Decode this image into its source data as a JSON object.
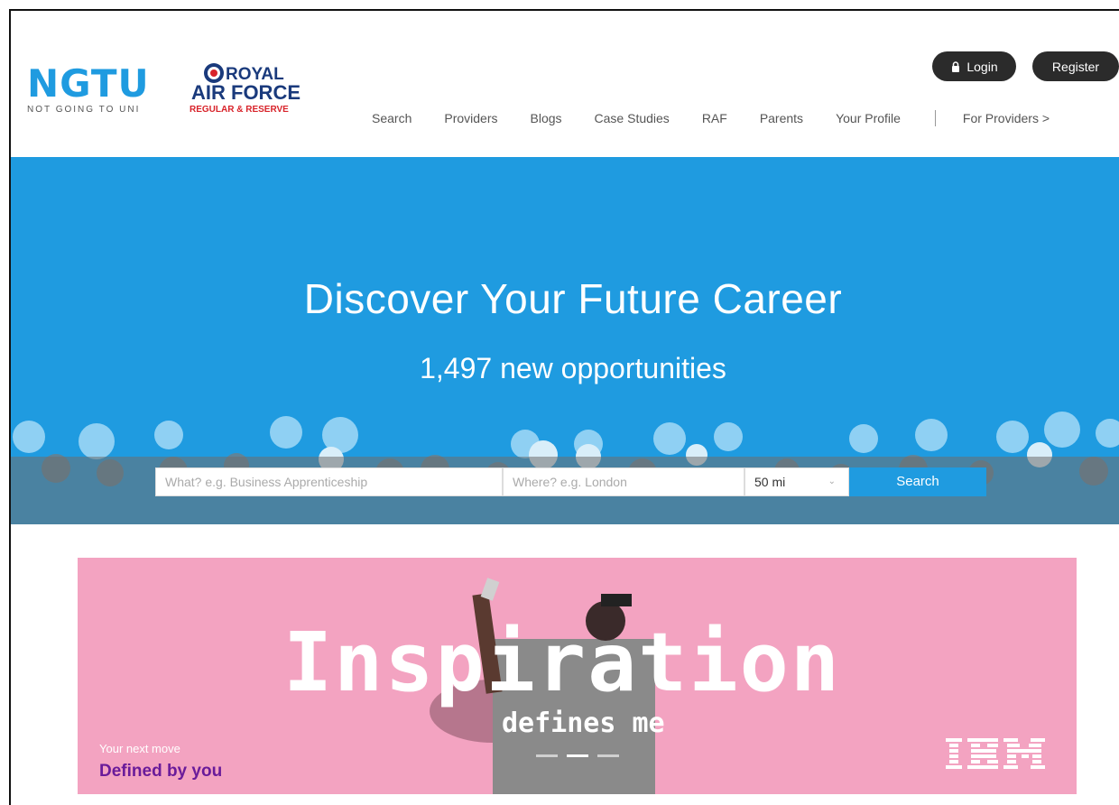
{
  "header": {
    "ngtu_logo": {
      "mark": "NGTU",
      "tagline": "NOT GOING TO UNI"
    },
    "raf_logo": {
      "line1": "ROYAL",
      "line2": "AIR FORCE",
      "line3": "REGULAR & RESERVE"
    },
    "login_label": "Login",
    "register_label": "Register",
    "nav": [
      {
        "label": "Search"
      },
      {
        "label": "Providers"
      },
      {
        "label": "Blogs"
      },
      {
        "label": "Case Studies"
      },
      {
        "label": "RAF"
      },
      {
        "label": "Parents"
      },
      {
        "label": "Your Profile"
      }
    ],
    "for_providers_label": "For Providers >"
  },
  "hero": {
    "title": "Discover Your Future Career",
    "subtitle": "1,497 new opportunities",
    "search": {
      "what_placeholder": "What? e.g. Business Apprenticeship",
      "where_placeholder": "Where? e.g. London",
      "radius_value": "50 mi",
      "button_label": "Search"
    }
  },
  "banner": {
    "headline": "Inspiration",
    "subline": "defines me",
    "next_move": "Your next move",
    "defined_by_you": "Defined by you",
    "ibm_logo": "IBM",
    "slides": 3,
    "active_slide": 2
  },
  "colors": {
    "brand_blue": "#1f9be0",
    "banner_pink": "#f3a3c1",
    "dark_button": "#2b2b2b",
    "raf_navy": "#1a3a7c",
    "raf_red": "#d8232a",
    "purple_text": "#6a1b9a"
  }
}
